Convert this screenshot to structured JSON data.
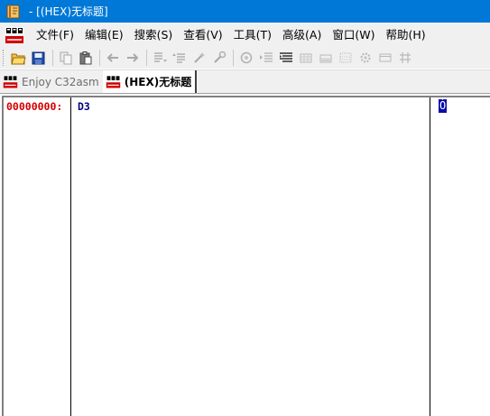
{
  "window": {
    "title": "- [(HEX)无标题]"
  },
  "menu": {
    "items": [
      {
        "label": "文件(F)"
      },
      {
        "label": "编辑(E)"
      },
      {
        "label": "搜索(S)"
      },
      {
        "label": "查看(V)"
      },
      {
        "label": "工具(T)"
      },
      {
        "label": "高级(A)"
      },
      {
        "label": "窗口(W)"
      },
      {
        "label": "帮助(H)"
      }
    ]
  },
  "tabs": [
    {
      "label": "Enjoy C32asm",
      "active": false
    },
    {
      "label": "(HEX)无标题",
      "active": true
    }
  ],
  "editor": {
    "address": "00000000:",
    "hex": "D3",
    "ascii": "Ó"
  },
  "colors": {
    "titlebar": "#0078d7",
    "address_text": "#d40000",
    "hex_text": "#000080",
    "selection": "#0a0aa8"
  }
}
